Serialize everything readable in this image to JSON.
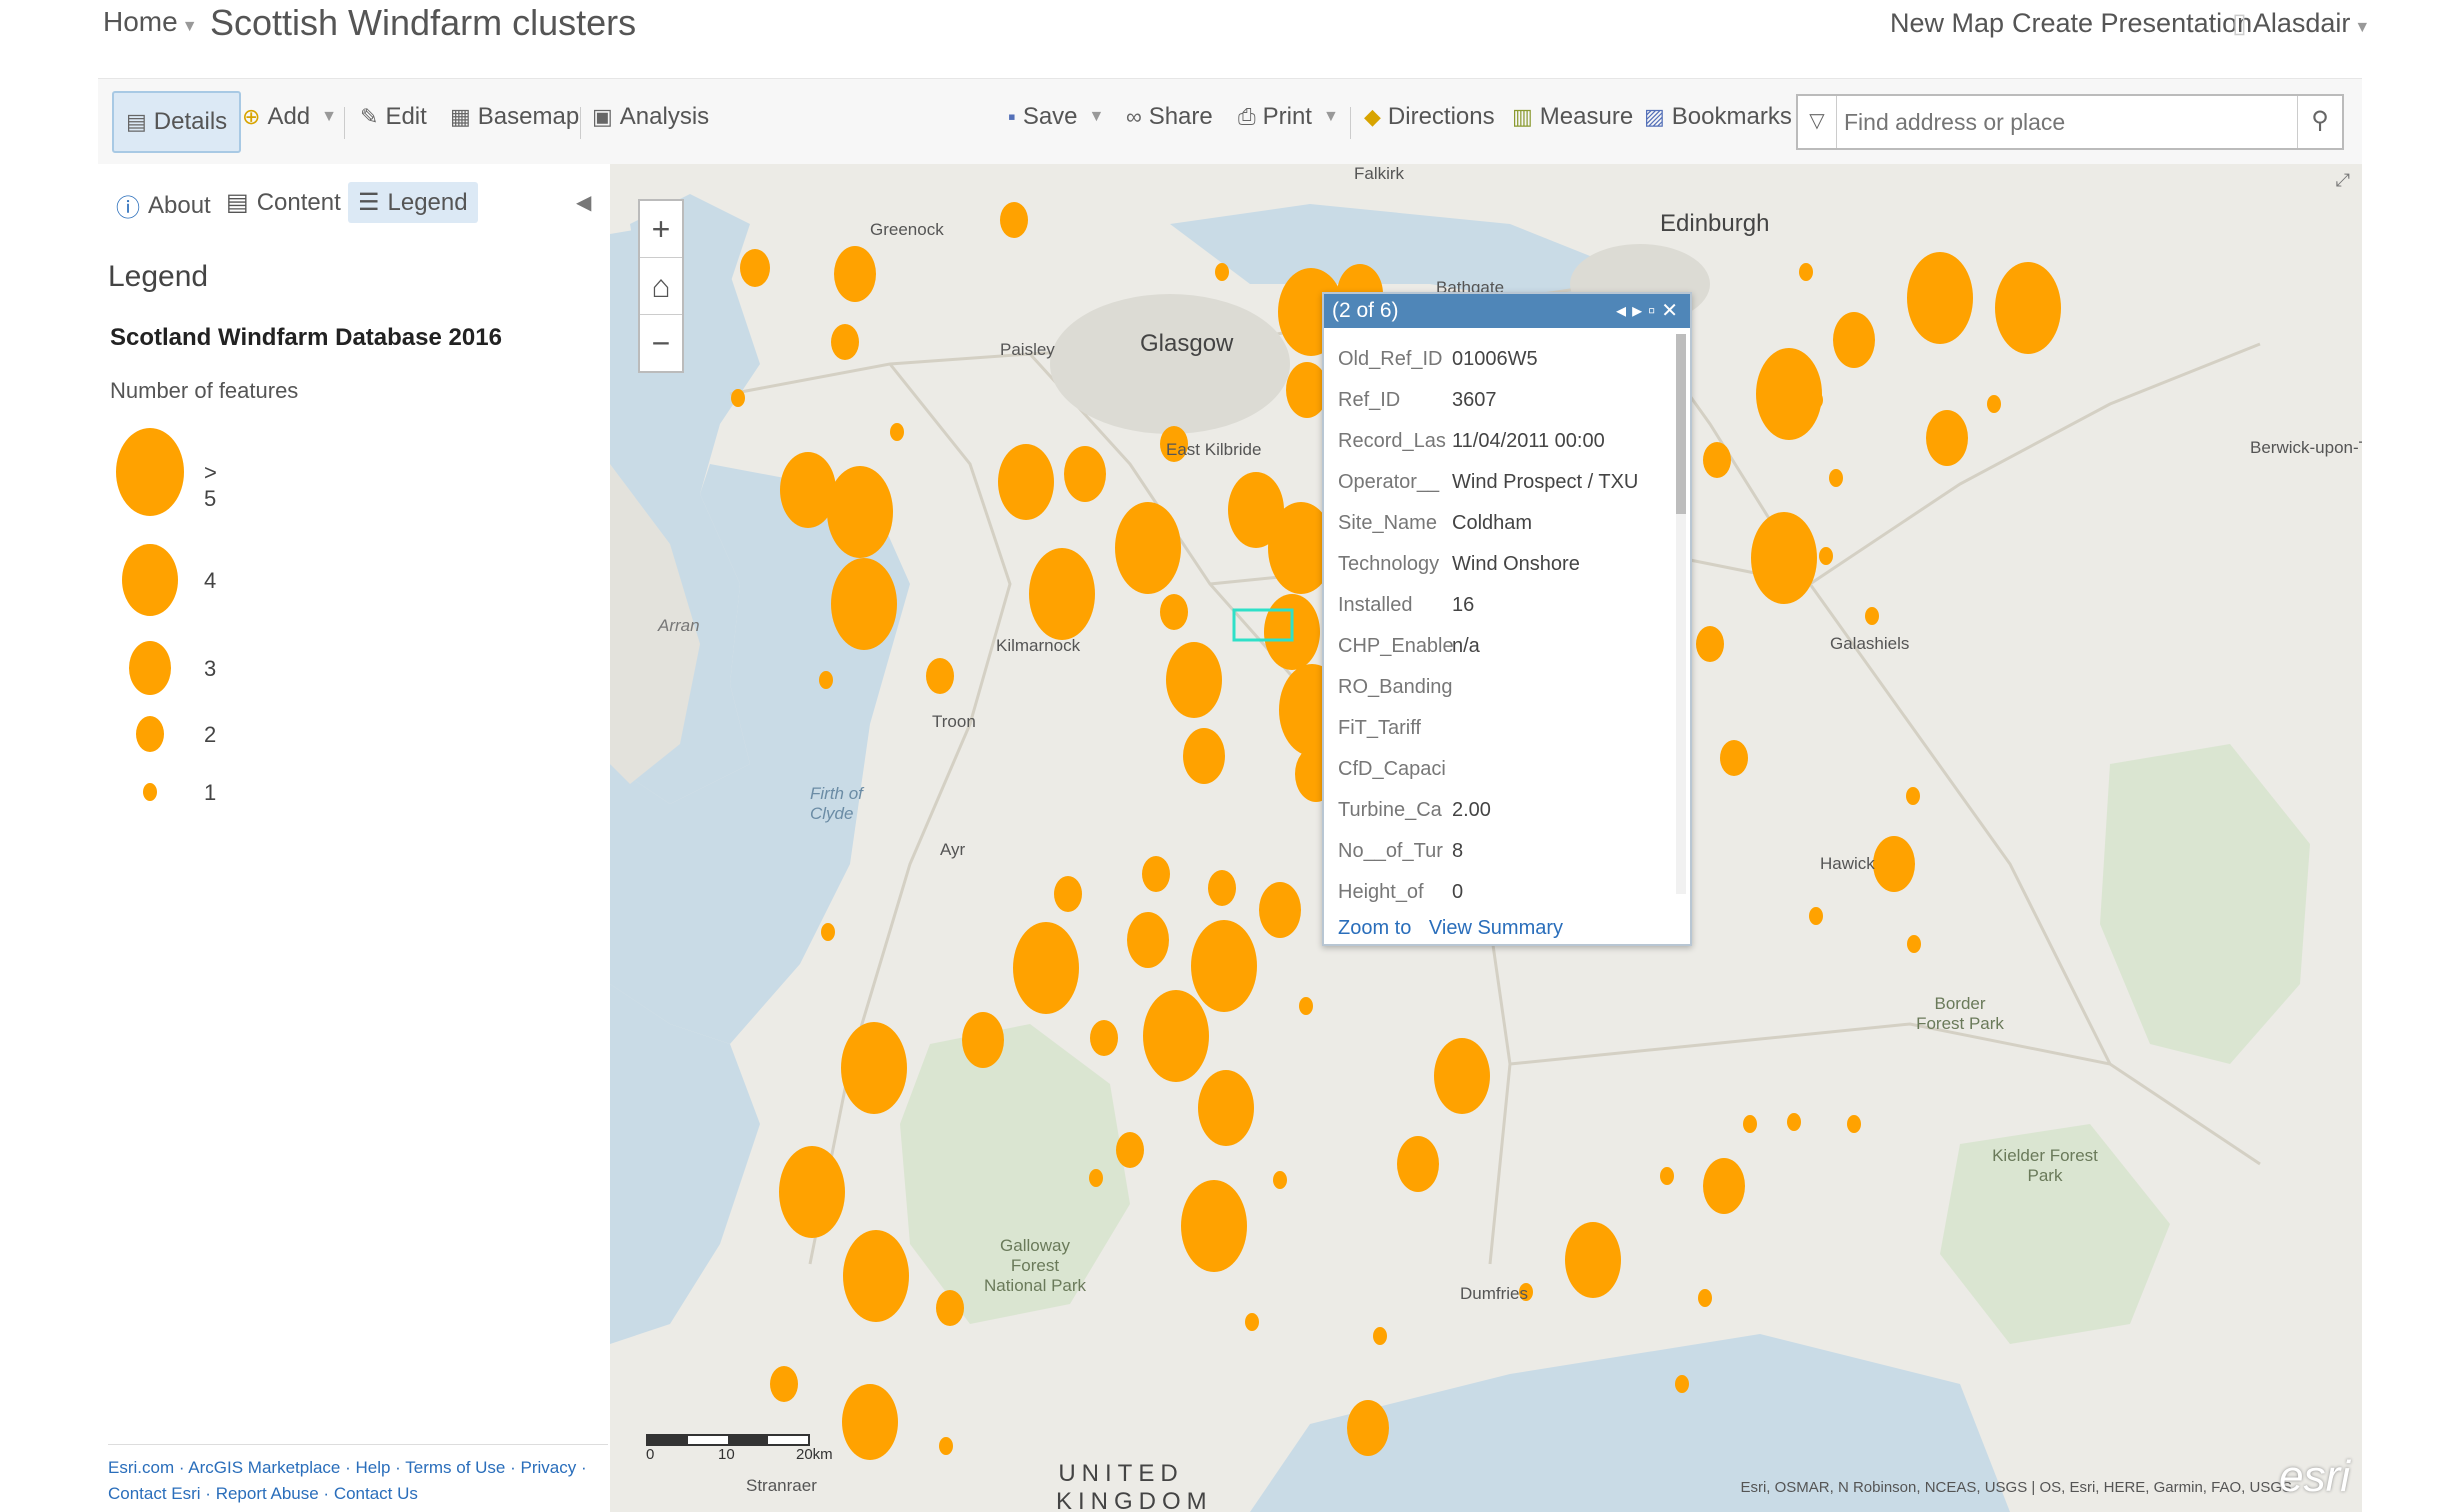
{
  "topnav": {
    "home": "Home",
    "title": "Scottish Windfarm clusters",
    "new_map": "New Map",
    "create_presentation": "Create Presentation",
    "user": "Alasdair"
  },
  "toolbar": {
    "details": "Details",
    "add": "Add",
    "edit": "Edit",
    "basemap": "Basemap",
    "analysis": "Analysis",
    "save": "Save",
    "share": "Share",
    "print": "Print",
    "directions": "Directions",
    "measure": "Measure",
    "bookmarks": "Bookmarks",
    "search_placeholder": "Find address or place"
  },
  "sidebar": {
    "tabs": {
      "about": "About",
      "content": "Content",
      "legend": "Legend"
    },
    "legend_heading": "Legend",
    "layer_name": "Scotland Windfarm Database 2016",
    "field_label": "Number of features",
    "classes": [
      {
        "label": "> 5"
      },
      {
        "label": "4"
      },
      {
        "label": "3"
      },
      {
        "label": "2"
      },
      {
        "label": "1"
      }
    ],
    "footer": {
      "line1": "Esri.com · ArcGIS Marketplace · Help · Terms of Use · Privacy ·",
      "line2": "Contact Esri · Report Abuse · Contact Us"
    }
  },
  "popup": {
    "title": "(2 of 6)",
    "fields": [
      {
        "k": "Old_Ref_ID",
        "v": "01006W5"
      },
      {
        "k": "Ref_ID",
        "v": "3607"
      },
      {
        "k": "Record_Las",
        "v": "11/04/2011 00:00"
      },
      {
        "k": "Operator__",
        "v": "Wind Prospect / TXU"
      },
      {
        "k": "Site_Name",
        "v": "Coldham"
      },
      {
        "k": "Technology",
        "v": "Wind Onshore"
      },
      {
        "k": "Installed",
        "v": "16"
      },
      {
        "k": "CHP_Enable",
        "v": "n/a"
      },
      {
        "k": "RO_Banding",
        "v": ""
      },
      {
        "k": "FiT_Tariff",
        "v": ""
      },
      {
        "k": "CfD_Capaci",
        "v": ""
      },
      {
        "k": "Turbine_Ca",
        "v": "2.00"
      },
      {
        "k": "No__of_Tur",
        "v": "8"
      },
      {
        "k": "Height_of",
        "v": "0"
      }
    ],
    "zoom_to": "Zoom to",
    "view_summary": "View Summary"
  },
  "map": {
    "places": {
      "edinburgh": "Edinburgh",
      "glasgow": "Glasgow",
      "greenock": "Greenock",
      "paisley": "Paisley",
      "east_kilbride": "East Kilbride",
      "kilmarnock": "Kilmarnock",
      "troon": "Troon",
      "ayr": "Ayr",
      "falkirk": "Falkirk",
      "bathgate": "Bathgate",
      "galashiels": "Galashiels",
      "hawick": "Hawick",
      "dumfries": "Dumfries",
      "berwick": "Berwick-upon-Tw",
      "firth_of_clyde": "Firth of Clyde",
      "arran": "Arran",
      "galloway": "Galloway Forest National Park",
      "kielder": "Kielder Forest Park",
      "border_forest": "Border Forest Park",
      "stranraer": "Stranraer",
      "uk": "UNITED KINGDOM"
    },
    "scale": {
      "s0": "0",
      "s10": "10",
      "s20": "20km"
    },
    "attribution": "Esri, OSMAR, N Robinson, NCEAS, USGS | OS, Esri, HERE, Garmin, FAO, USGS",
    "brand": "esri",
    "accent": "#ffa200"
  }
}
